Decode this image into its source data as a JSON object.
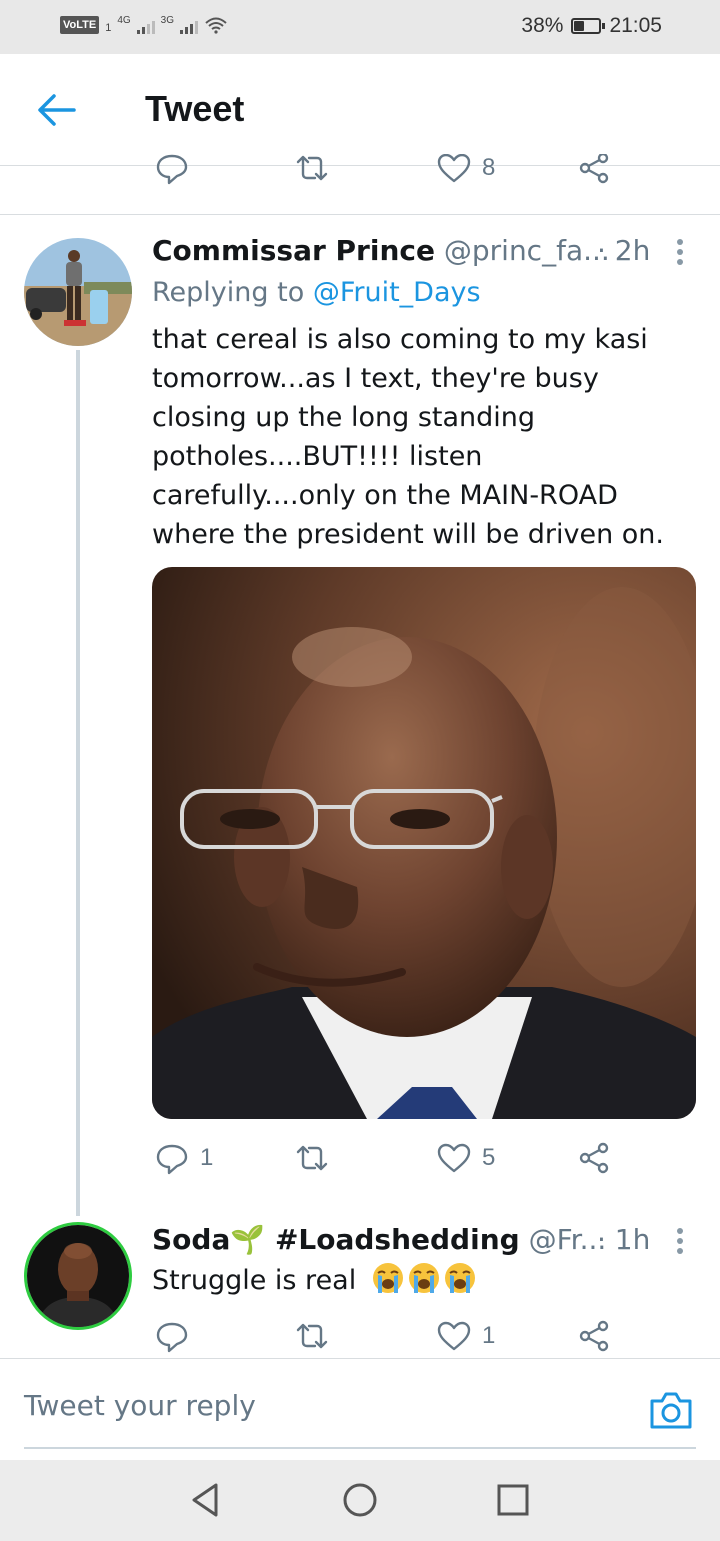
{
  "status_bar": {
    "volte": "VoLTE",
    "sim_slot": "1",
    "network_1": "4G",
    "network_2": "3G",
    "battery_percent": "38%",
    "battery_level": 0.38,
    "time": "21:05"
  },
  "header": {
    "title": "Tweet"
  },
  "top_actions": {
    "like_count": "8"
  },
  "tweets": [
    {
      "name": "Commissar Prince",
      "handle": "@princ_fa...",
      "time": "· 2h",
      "replying_prefix": "Replying to",
      "replying_to": "@Fruit_Days",
      "text": "that cereal is also coming to my kasi tomorrow...as I text, they're busy closing up the long standing potholes....BUT!!!! listen carefully....only on the MAIN-ROAD where the president will be driven on.",
      "reply_count": "1",
      "like_count": "5"
    },
    {
      "name": "Soda🌱 #Loadshedding",
      "handle": "@Fr...",
      "time": "· 1h",
      "text": "Struggle is real",
      "reply_count": "",
      "like_count": "1"
    }
  ],
  "reply_bar": {
    "placeholder": "Tweet your reply"
  },
  "icons": {
    "back": "back-arrow-icon",
    "reply": "reply-bubble-icon",
    "retweet": "retweet-icon",
    "like": "heart-icon",
    "share": "share-icon",
    "more": "more-vertical-icon",
    "camera": "camera-icon",
    "emoji": "loudly-crying-face-emoji"
  },
  "colors": {
    "accent": "#1b95e0",
    "secondary_text": "#657786",
    "divider": "#d9dde0",
    "status_bar_bg": "#e8e8e8",
    "nav_bar_bg": "#ececec"
  }
}
